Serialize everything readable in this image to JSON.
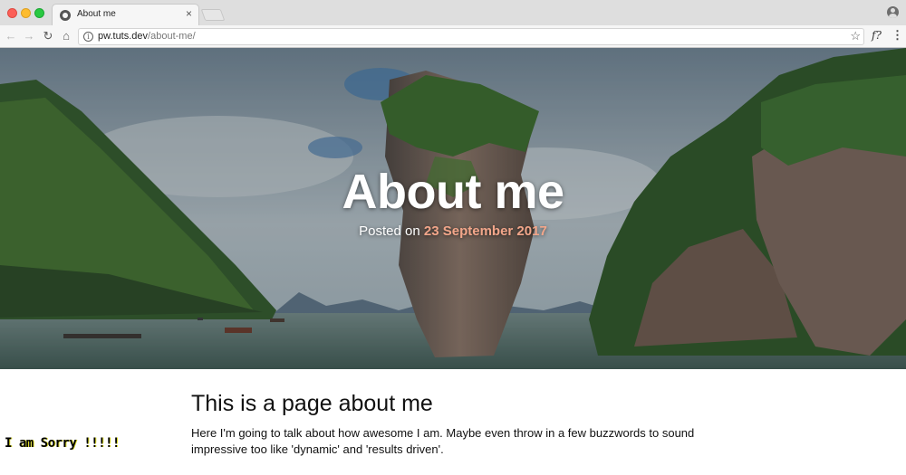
{
  "browser": {
    "tab_title": "About me",
    "tab_close": "×",
    "url_host": "pw.tuts.dev",
    "url_path": "/about-me/",
    "info_glyph": "i",
    "star_glyph": "☆",
    "ext_glyph": "f?",
    "menu_glyph": "⋮",
    "back_glyph": "←",
    "forward_glyph": "→",
    "reload_glyph": "↻",
    "home_glyph": "⌂"
  },
  "hero": {
    "title": "About me",
    "posted_prefix": "Posted on ",
    "date": "23 September 2017"
  },
  "main": {
    "heading": "This is a page about me",
    "body": "Here I'm going to talk about how awesome I am. Maybe even throw in a few buzzwords to sound impressive too like 'dynamic' and 'results driven'."
  },
  "overlay_text": "I am Sorry !!!!!",
  "colors": {
    "date_accent": "#f2a68a",
    "sky": "#8a9ba5",
    "water": "#5f7770",
    "foliage": "#3f6a2c",
    "rock": "#6b5a4e"
  }
}
